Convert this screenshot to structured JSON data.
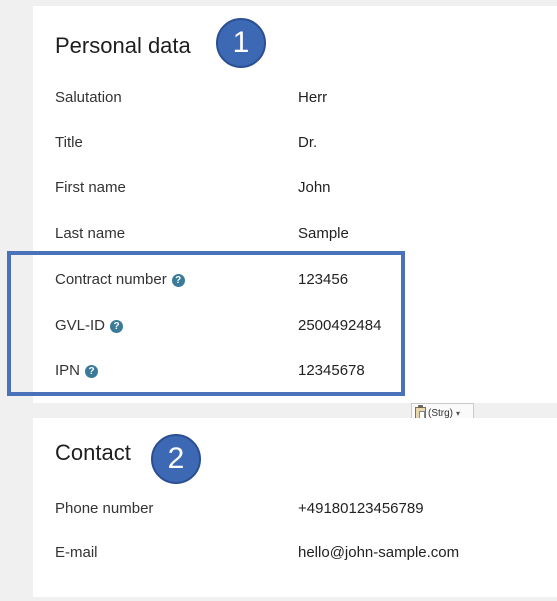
{
  "personal": {
    "title": "Personal data",
    "badge": "1",
    "rows": [
      {
        "label": "Salutation",
        "value": "Herr"
      },
      {
        "label": "Title",
        "value": "Dr."
      },
      {
        "label": "First name",
        "value": "John"
      },
      {
        "label": "Last name",
        "value": "Sample"
      },
      {
        "label": "Contract number",
        "value": "123456",
        "help": "?"
      },
      {
        "label": "GVL-ID",
        "value": "2500492484",
        "help": "?"
      },
      {
        "label": "IPN",
        "value": "12345678",
        "help": "?"
      }
    ]
  },
  "paste_options": {
    "label": "(Strg)",
    "caret": "▾"
  },
  "contact": {
    "title": "Contact",
    "badge": "2",
    "rows": [
      {
        "label": "Phone number",
        "value": "+49180123456789"
      },
      {
        "label": "E-mail",
        "value": "hello@john-sample.com"
      }
    ]
  },
  "colors": {
    "badge": "#3d68b4",
    "highlight_border": "#4a72b8",
    "help_icon": "#3a7a9a"
  }
}
